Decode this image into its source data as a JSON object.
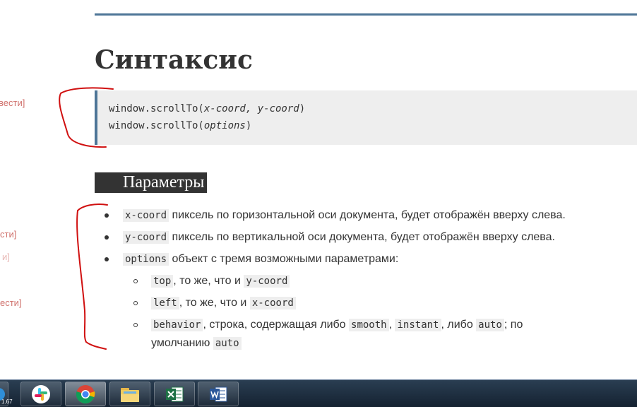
{
  "page": {
    "title": "Синтаксис",
    "syntax_lines": [
      {
        "fn": "window.scrollTo(",
        "args": "x-coord, y-coord",
        "close": ")"
      },
      {
        "fn": "window.scrollTo(",
        "args": "options",
        "close": ")"
      }
    ],
    "params_heading": "Параметры",
    "params": {
      "x_coord": {
        "code": "x-coord",
        "text": " пиксель по горизонтальной оси документа, будет отображён вверху слева."
      },
      "y_coord": {
        "code": "y-coord",
        "text": " пиксель по вертикальной оси документа, будет отображён вверху слева."
      },
      "options": {
        "code": "options",
        "text": " объект с тремя возможными параметрами:"
      },
      "top": {
        "code": "top",
        "text": ", то же, что и ",
        "ref": "y-coord"
      },
      "left": {
        "code": "left",
        "text": ", то же, что и ",
        "ref": "x-coord"
      },
      "behavior": {
        "code": "behavior",
        "text1": ", строка, содержащая либо ",
        "v1": "smooth",
        "sep": ", ",
        "v2": "instant",
        "text2": ", либо ",
        "v3": "auto",
        "text3": "; по",
        "line2": "умолчанию ",
        "v4": "auto"
      }
    }
  },
  "sidebar_fragments": [
    "вести]",
    "сти]",
    "и]",
    "ести]"
  ],
  "taskbar": {
    "tray_text": "1.67",
    "apps": [
      {
        "name": "Slack",
        "icon": "slack-icon"
      },
      {
        "name": "Google Chrome",
        "icon": "chrome-icon"
      },
      {
        "name": "File Explorer",
        "icon": "folder-icon"
      },
      {
        "name": "Microsoft Excel",
        "icon": "excel-icon"
      },
      {
        "name": "Microsoft Word",
        "icon": "word-icon"
      }
    ]
  },
  "colors": {
    "accent": "#4d7597",
    "text": "#333333",
    "code_bg": "#eeeeee",
    "annotation": "#d01010",
    "sidebar_link": "#d0716c"
  }
}
